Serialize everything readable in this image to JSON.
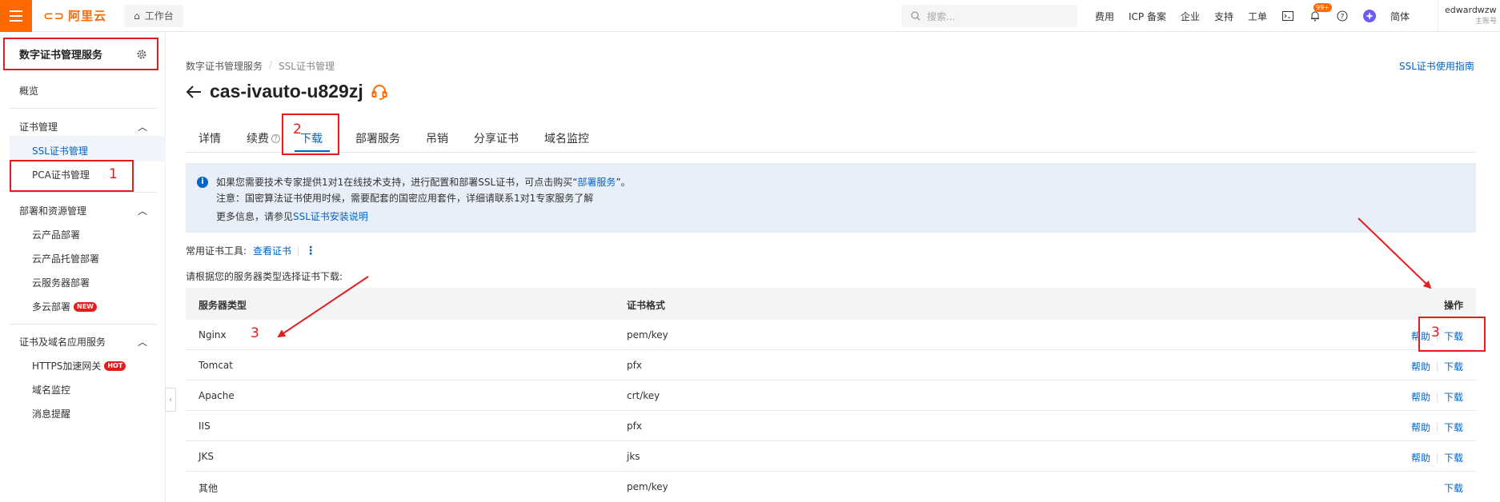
{
  "topbar": {
    "logo": "阿里云",
    "workbench": "工作台",
    "search_placeholder": "搜索...",
    "nav": [
      "费用",
      "ICP 备案",
      "企业",
      "支持",
      "工单"
    ],
    "notification_badge": "99+",
    "language": "简体",
    "username": "edwardwzw",
    "account_type": "主账号"
  },
  "sidebar": {
    "title": "数字证书管理服务",
    "overview": "概览",
    "groups": [
      {
        "label": "证书管理",
        "items": [
          {
            "label": "SSL证书管理",
            "active": true
          },
          {
            "label": "PCA证书管理"
          }
        ]
      },
      {
        "label": "部署和资源管理",
        "items": [
          {
            "label": "云产品部署"
          },
          {
            "label": "云产品托管部署"
          },
          {
            "label": "云服务器部署"
          },
          {
            "label": "多云部署",
            "tag": "NEW"
          }
        ]
      },
      {
        "label": "证书及域名应用服务",
        "items": [
          {
            "label": "HTTPS加速网关",
            "tag": "HOT"
          },
          {
            "label": "域名监控"
          },
          {
            "label": "消息提醒"
          }
        ]
      }
    ]
  },
  "breadcrumb": [
    "数字证书管理服务",
    "SSL证书管理"
  ],
  "guide_link": "SSL证书使用指南",
  "page_title": "cas-ivauto-u829zj",
  "tabs": [
    "详情",
    "续费",
    "下载",
    "部署服务",
    "吊销",
    "分享证书",
    "域名监控"
  ],
  "active_tab": "下载",
  "info": {
    "line1_prefix": "如果您需要技术专家提供1对1在线技术支持，进行配置和部署SSL证书，可点击购买“",
    "line1_link": "部署服务",
    "line1_suffix": "”。",
    "line2": "注意：国密算法证书使用时候，需要配套的国密应用套件，详细请联系1对1专家服务了解",
    "line3_prefix": "更多信息，请参见",
    "line3_link": "SSL证书安装说明"
  },
  "tools": {
    "label": "常用证书工具:",
    "link": "查看证书"
  },
  "hint": "请根据您的服务器类型选择证书下载:",
  "table": {
    "headers": [
      "服务器类型",
      "证书格式",
      "操作"
    ],
    "rows": [
      {
        "type": "Nginx",
        "format": "pem/key",
        "help": "帮助",
        "download": "下载"
      },
      {
        "type": "Tomcat",
        "format": "pfx",
        "help": "帮助",
        "download": "下载"
      },
      {
        "type": "Apache",
        "format": "crt/key",
        "help": "帮助",
        "download": "下载"
      },
      {
        "type": "IIS",
        "format": "pfx",
        "help": "帮助",
        "download": "下载"
      },
      {
        "type": "JKS",
        "format": "jks",
        "help": "帮助",
        "download": "下载"
      },
      {
        "type": "其他",
        "format": "pem/key",
        "help": "",
        "download": "下载"
      }
    ]
  },
  "annotations": {
    "n1": "1",
    "n2": "2",
    "n3a": "3",
    "n3b": "3"
  },
  "colors": {
    "brand": "#ff6a00",
    "link": "#0064c8",
    "annotation": "#e31d1d"
  }
}
